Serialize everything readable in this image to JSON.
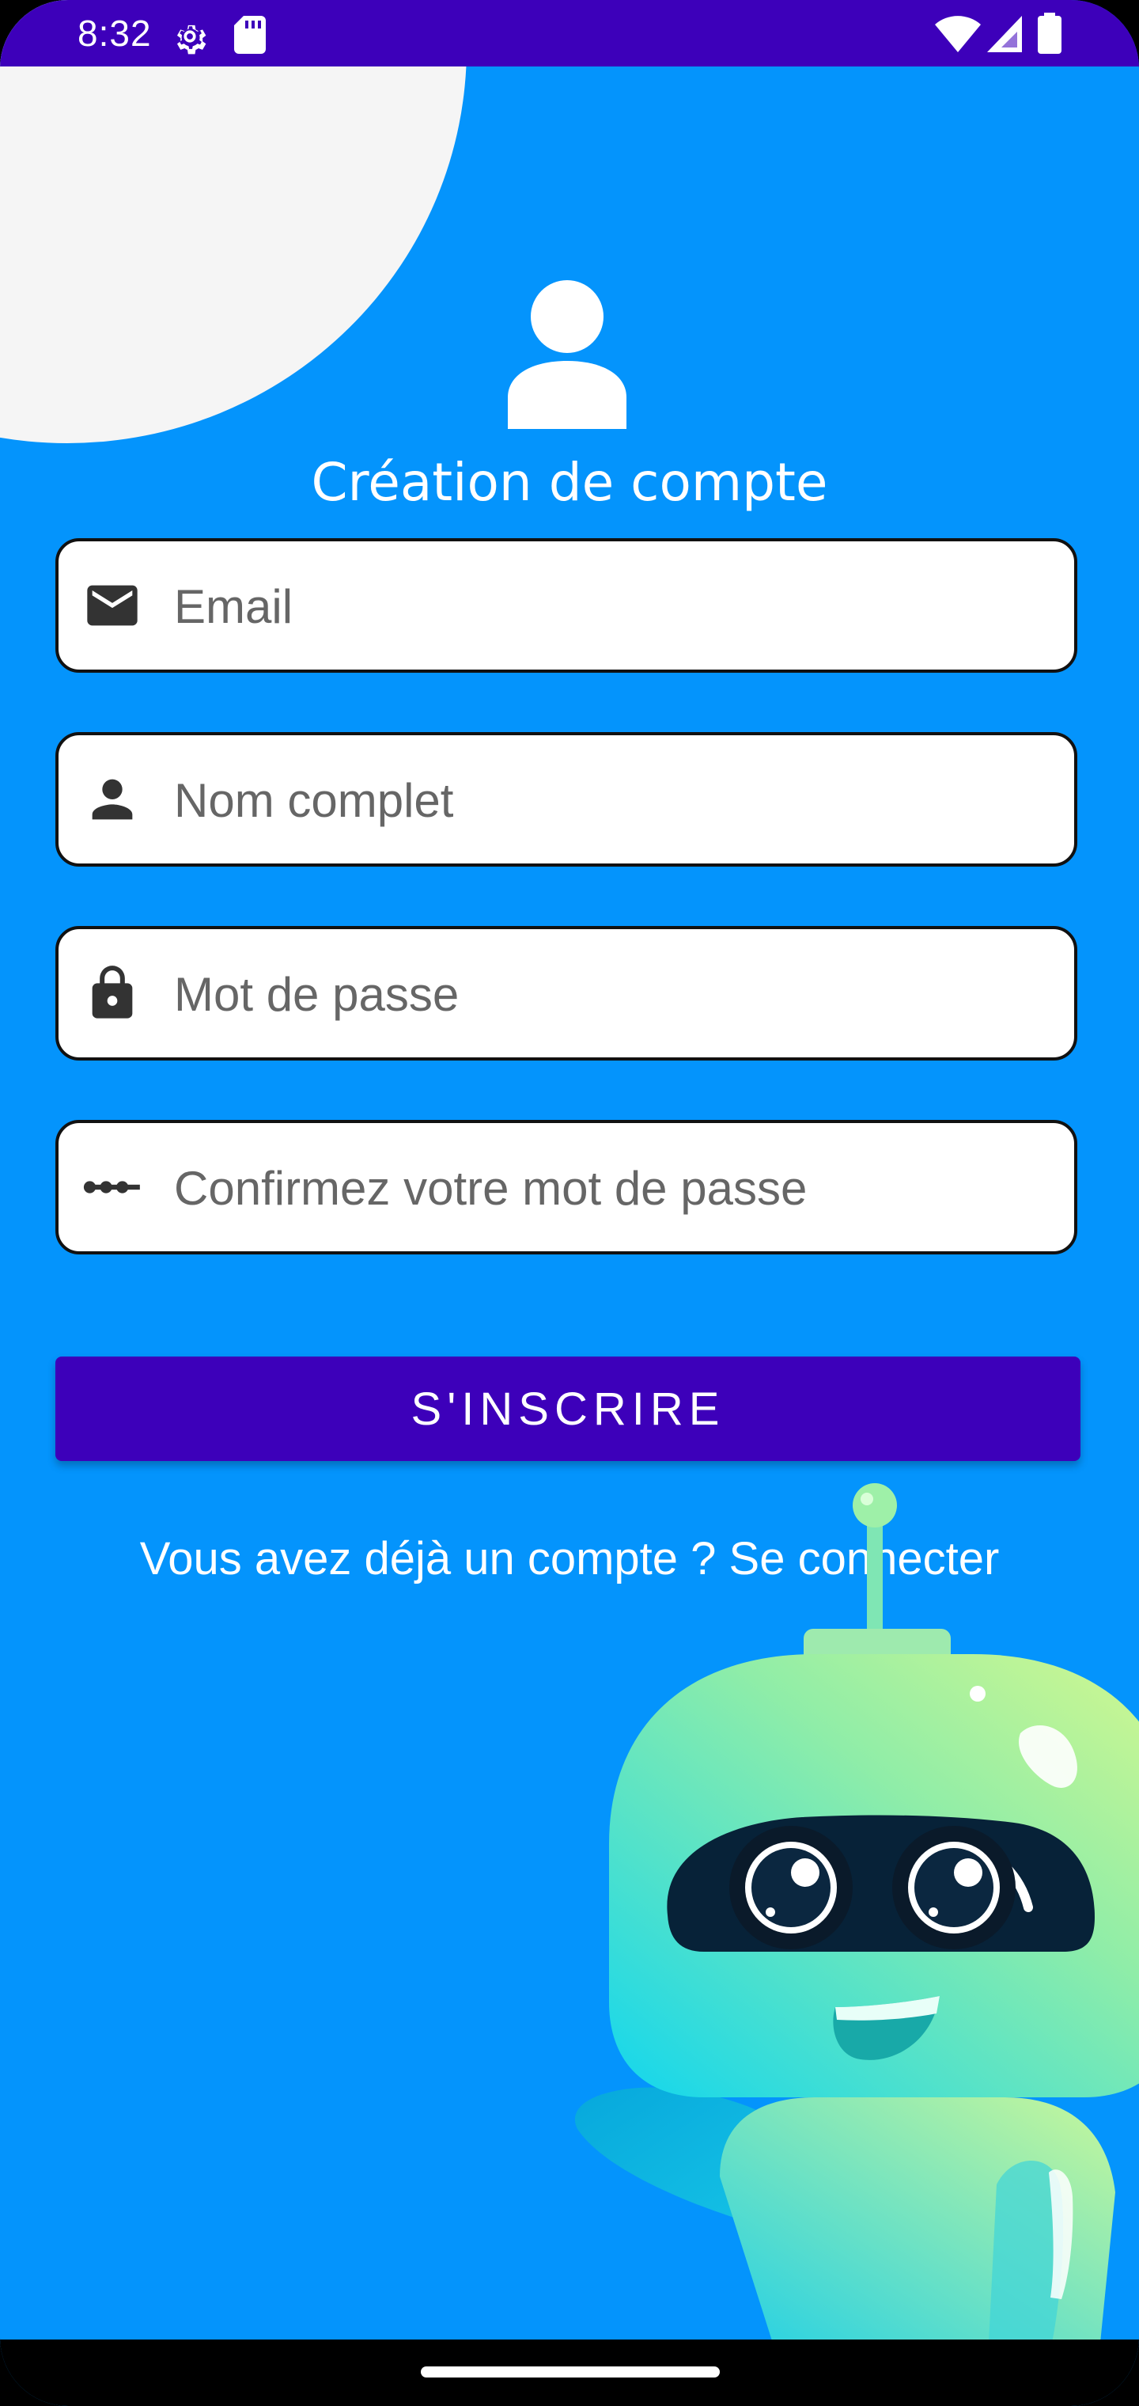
{
  "status_bar": {
    "time": "8:32",
    "left_icons": [
      "settings-gear-icon",
      "sd-card-icon"
    ],
    "right_icons": [
      "wifi-icon",
      "signal-icon",
      "battery-icon"
    ],
    "color": "#3D00BA"
  },
  "header": {
    "icon": "account-icon",
    "title": "Création de compte"
  },
  "form": {
    "email": {
      "icon": "email-icon",
      "placeholder": "Email",
      "value": ""
    },
    "full_name": {
      "icon": "person-icon",
      "placeholder": "Nom complet",
      "value": ""
    },
    "password": {
      "icon": "lock-icon",
      "placeholder": "Mot de passe",
      "value": ""
    },
    "confirm_password": {
      "icon": "password-dots-icon",
      "placeholder": "Confirmez votre mot de passe",
      "value": ""
    }
  },
  "signup_button": {
    "label": "S'INSCRIRE",
    "color": "#3D00BA"
  },
  "login_prompt": "Vous avez déjà un compte ? Se connecter",
  "colors": {
    "background": "#0494FC",
    "decor_circle": "#F5F5F5",
    "accent": "#3D00BA"
  },
  "illustration": "robot-mascot"
}
